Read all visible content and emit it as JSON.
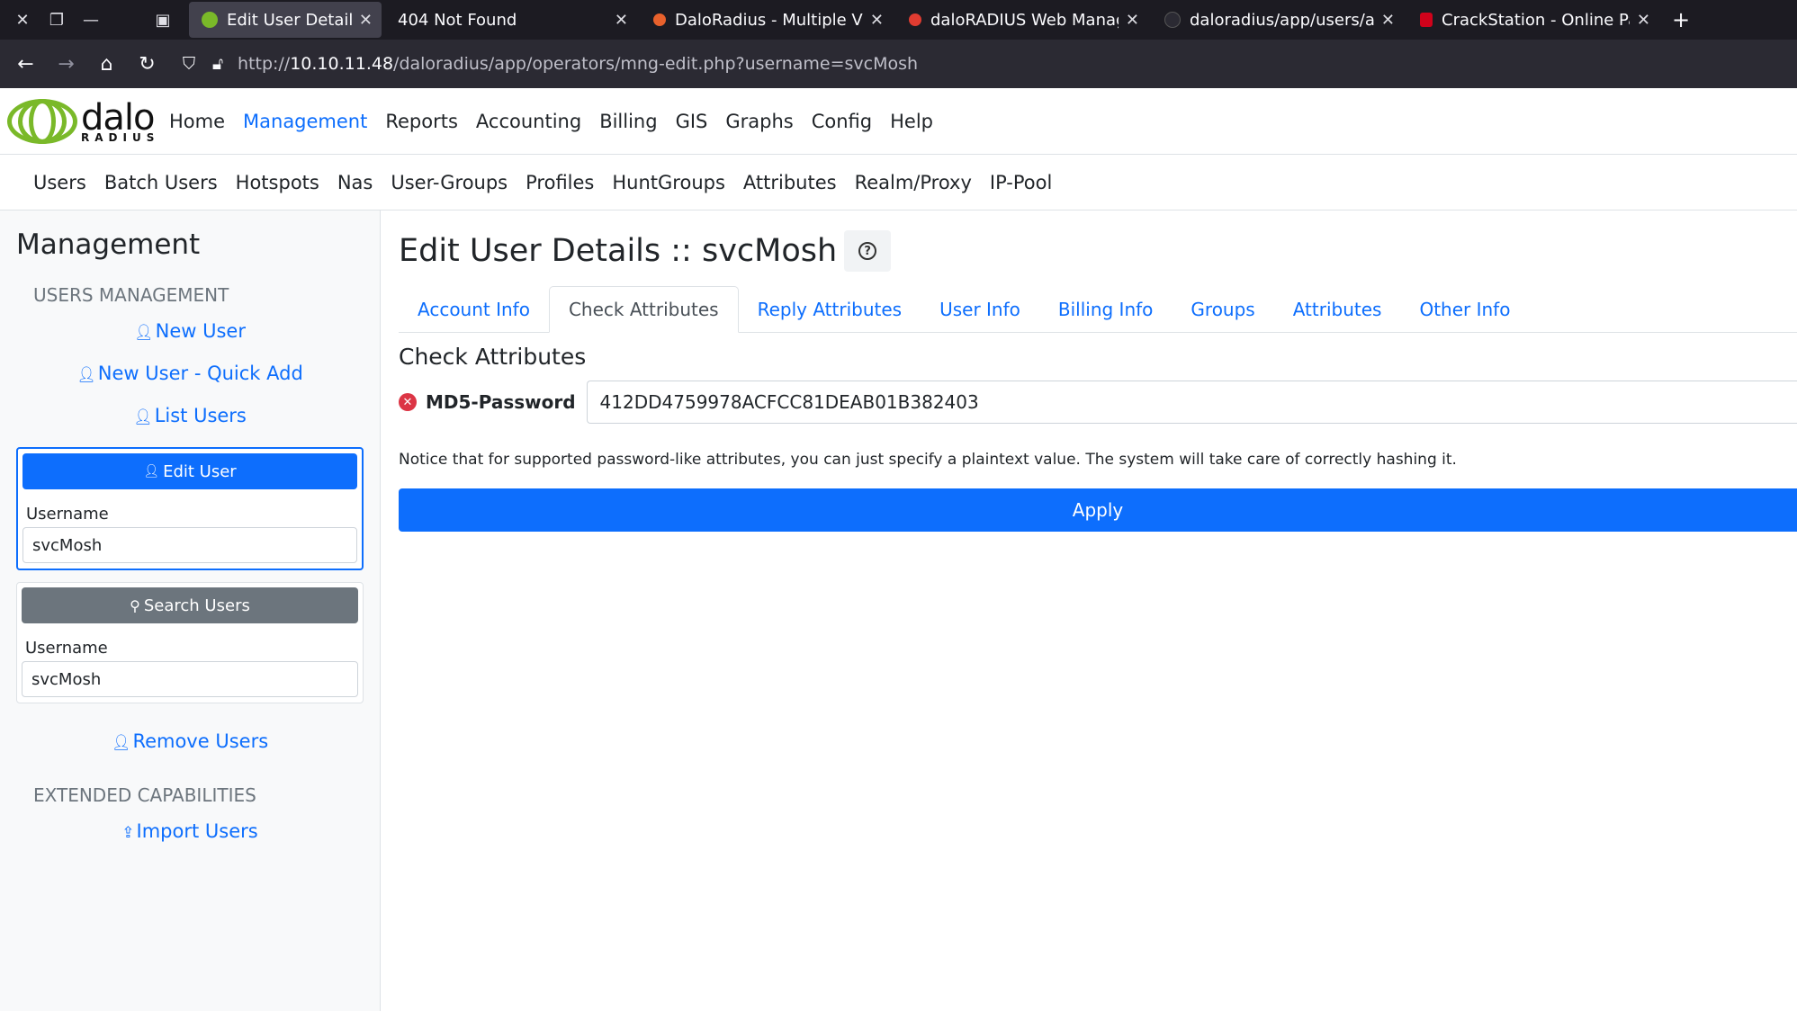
{
  "browser": {
    "tabs": [
      {
        "title": "Edit User Details :: daloRA",
        "active": true,
        "favicon_color": "#7ab929"
      },
      {
        "title": "404 Not Found",
        "active": false,
        "favicon_color": ""
      },
      {
        "title": "DaloRadius - Multiple Vul",
        "active": false,
        "favicon_color": "#e8612c"
      },
      {
        "title": "daloRADIUS Web Manage",
        "active": false,
        "favicon_color": "#e03c31"
      },
      {
        "title": "daloradius/app/users/acc",
        "active": false,
        "favicon_color": "#2b2a33"
      },
      {
        "title": "CrackStation - Online Pas",
        "active": false,
        "favicon_color": "#d0021b"
      }
    ],
    "url_prefix": "http://",
    "url_host": "10.10.11.48",
    "url_path": "/daloradius/app/operators/mng-edit.php?username=svcMosh"
  },
  "header": {
    "logo_text": "dalo",
    "logo_sub": "RADIUS",
    "nav": [
      "Home",
      "Management",
      "Reports",
      "Accounting",
      "Billing",
      "GIS",
      "Graphs",
      "Config",
      "Help"
    ],
    "active_nav": "Management"
  },
  "subnav": [
    "Users",
    "Batch Users",
    "Hotspots",
    "Nas",
    "User-Groups",
    "Profiles",
    "HuntGroups",
    "Attributes",
    "Realm/Proxy",
    "IP-Pool"
  ],
  "sidebar": {
    "title": "Management",
    "section1": "USERS MANAGEMENT",
    "new_user": "New User",
    "new_user_quick": "New User - Quick Add",
    "list_users": "List Users",
    "edit_card": {
      "button": "Edit User",
      "label": "Username",
      "value": "svcMosh"
    },
    "search_card": {
      "button": "Search Users",
      "label": "Username",
      "value": "svcMosh"
    },
    "remove_users": "Remove Users",
    "section2": "EXTENDED CAPABILITIES",
    "import_users": "Import Users"
  },
  "main": {
    "title": "Edit User Details :: svcMosh",
    "help_icon": "question-circle-icon",
    "tabs": [
      "Account Info",
      "Check Attributes",
      "Reply Attributes",
      "User Info",
      "Billing Info",
      "Groups",
      "Attributes",
      "Other Info"
    ],
    "active_tab": "Check Attributes",
    "section_title": "Check Attributes",
    "attribute": {
      "name": "MD5-Password",
      "value": "412DD4759978ACFCC81DEAB01B382403"
    },
    "notice": "Notice that for supported password-like attributes, you can just specify a plaintext value. The system will take care of correctly hashing it.",
    "apply": "Apply"
  },
  "colors": {
    "accent": "#0d6efd",
    "danger": "#dc3545",
    "secondary": "#6c757d",
    "logo": "#7ab929"
  }
}
